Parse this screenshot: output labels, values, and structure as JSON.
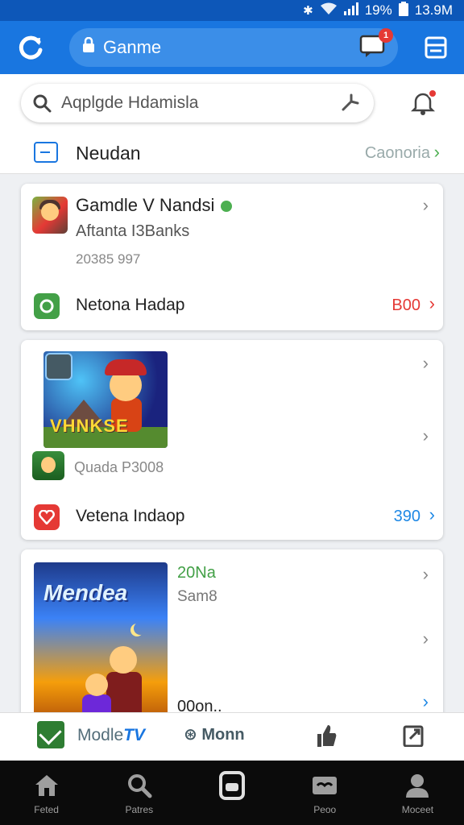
{
  "status_bar": {
    "battery_pct": "19%",
    "time": "13.9M"
  },
  "app_bar": {
    "url_text": "Ganme",
    "chat_badge": "1"
  },
  "search": {
    "placeholder": "Aqplgde Hdamisla"
  },
  "nav_row": {
    "label": "Neudan",
    "link": "Caonoria"
  },
  "cards": [
    {
      "title": "Gamdle V Nandsi",
      "subtitle": "Aftanta I3Banks",
      "meta": "20385 997",
      "footer_label": "Netona Hadap",
      "footer_value": "B00"
    },
    {
      "poster_text": "VHNKSE",
      "meta": "Quada P3008",
      "footer_label": "Vetena Indaop",
      "footer_value": "390"
    },
    {
      "poster_text": "Mendea",
      "tag": "20Na",
      "subtitle": "Sam8",
      "footer": "00on.."
    }
  ],
  "toolbar": {
    "item1_label": "Modle",
    "item1_suffix": "TV",
    "item2_label": "Monn"
  },
  "bottom_nav": [
    {
      "label": "Feted"
    },
    {
      "label": "Patres"
    },
    {
      "label": ""
    },
    {
      "label": "Peoo"
    },
    {
      "label": "Moceet"
    }
  ],
  "colors": {
    "primary": "#1976e0",
    "status_bar": "#0d57b8",
    "accent_red": "#e53935",
    "accent_green": "#43a047",
    "link_blue": "#1e88e5"
  }
}
